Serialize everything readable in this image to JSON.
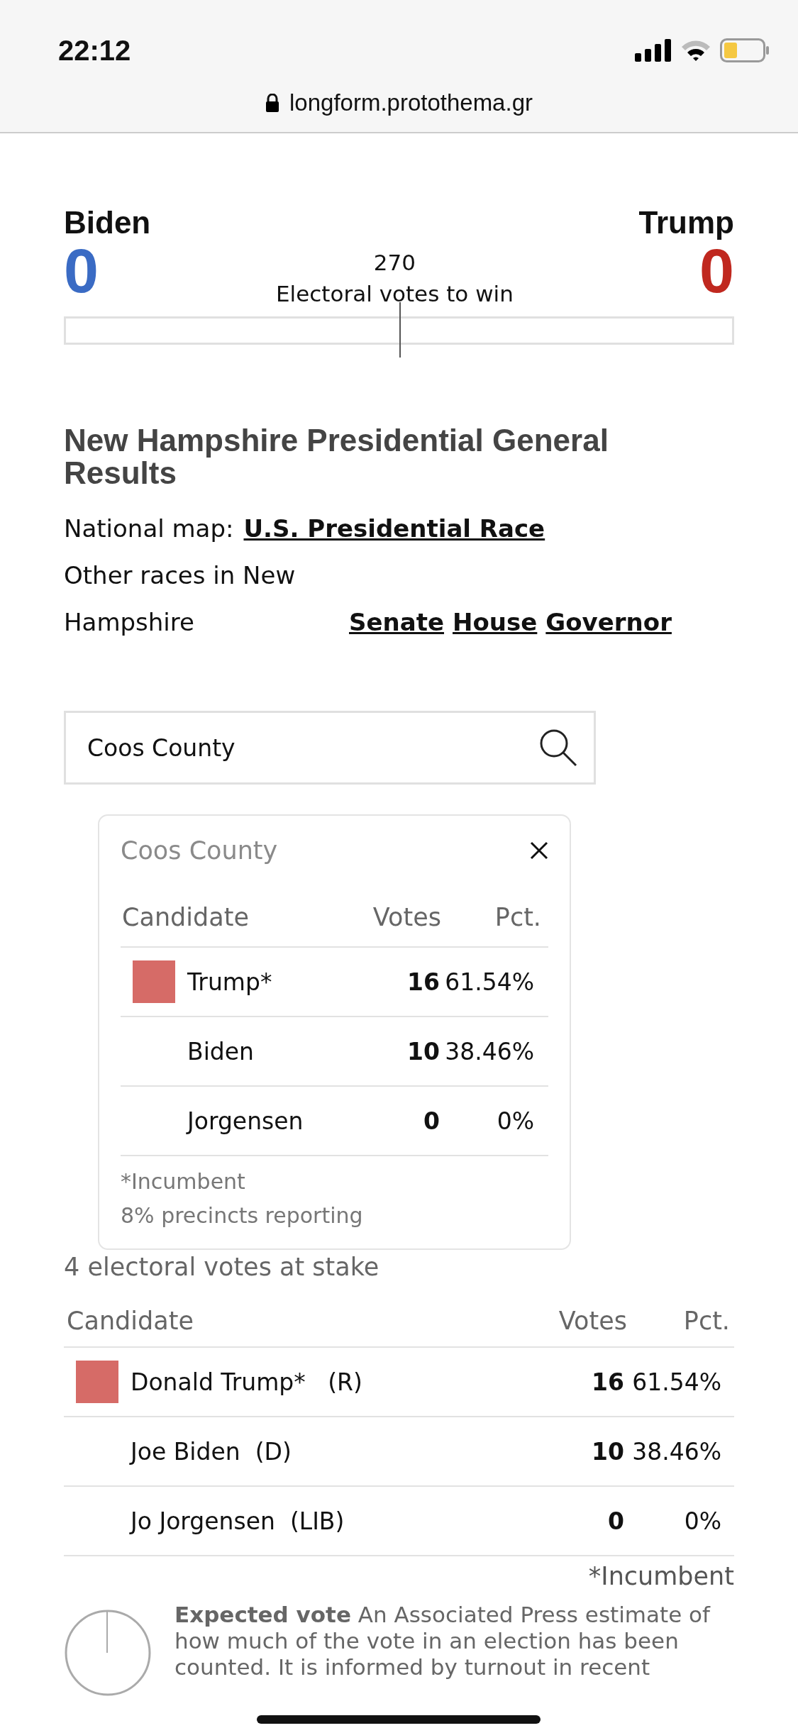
{
  "status_bar": {
    "time": "22:12",
    "url": "longform.protothema.gr"
  },
  "scoreboard": {
    "left": {
      "name": "Biden",
      "votes": "0",
      "color": "#3a6bc4"
    },
    "right": {
      "name": "Trump",
      "votes": "0",
      "color": "#c0281f"
    },
    "target": "270",
    "target_label": "Electoral votes to win"
  },
  "heading": "New Hampshire Presidential General Results",
  "national": {
    "label": "National map:",
    "link": "U.S. Presidential Race"
  },
  "other_races": {
    "label": "Other races in New Hampshire",
    "links": [
      "Senate",
      "House",
      "Governor"
    ]
  },
  "search": {
    "value": "Coos County"
  },
  "popup": {
    "title": "Coos County",
    "columns": [
      "Candidate",
      "Votes",
      "Pct."
    ],
    "rows": [
      {
        "name": "Trump*",
        "votes": "16",
        "pct": "61.54%",
        "winner": true
      },
      {
        "name": "Biden",
        "votes": "10",
        "pct": "38.46%",
        "winner": false
      },
      {
        "name": "Jorgensen",
        "votes": "0",
        "pct": "0%",
        "winner": false
      }
    ],
    "notes": [
      "*Incumbent",
      "8% precincts reporting"
    ]
  },
  "stake": "4 electoral votes at stake",
  "results": {
    "columns": [
      "Candidate",
      "Votes",
      "Pct."
    ],
    "rows": [
      {
        "name": "Donald Trump*   (R)",
        "votes": "16",
        "pct": "61.54%",
        "winner": true
      },
      {
        "name": "Joe Biden  (D)",
        "votes": "10",
        "pct": "38.46%",
        "winner": false
      },
      {
        "name": "Jo Jorgensen  (LIB)",
        "votes": "0",
        "pct": "0%",
        "winner": false
      }
    ],
    "footnote": "*Incumbent"
  },
  "expected_vote": "**Expected vote** An Associated Press estimate of how much of the vote in an election has been counted. It is informed by turnout in recent"
}
